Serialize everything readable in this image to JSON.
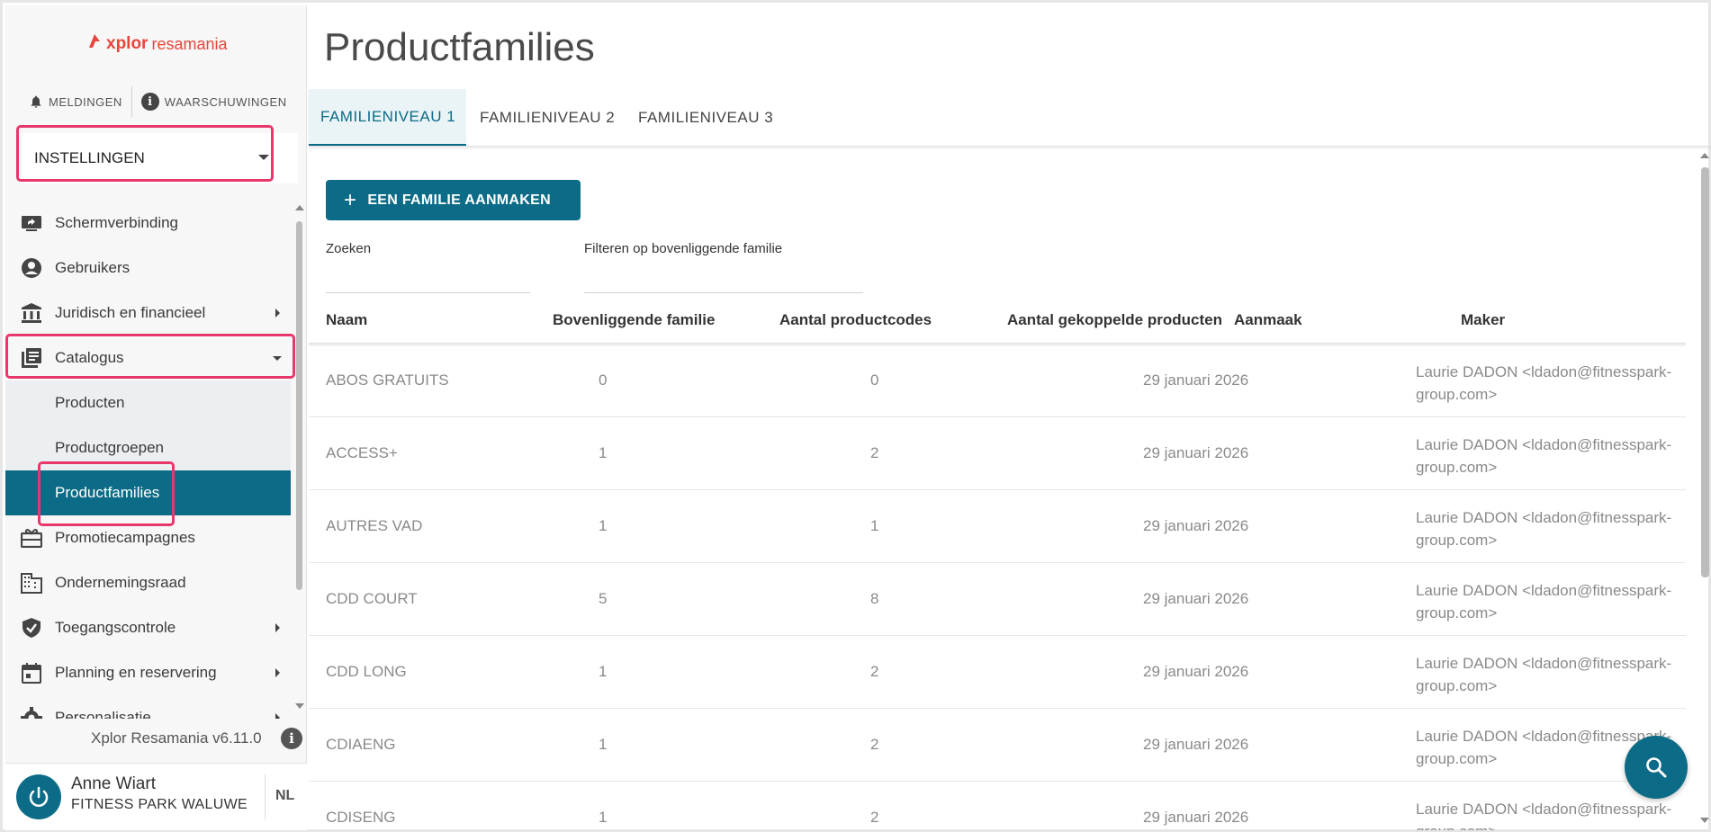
{
  "brand": {
    "logo_text_x": "xplor",
    "logo_text_r": "resamania"
  },
  "header_alerts": {
    "notifications": "MELDINGEN",
    "warnings": "WAARSCHUWINGEN"
  },
  "section_select": {
    "value": "INSTELLINGEN"
  },
  "sidebar": {
    "items": [
      {
        "label": "Schermverbinding",
        "icon": "screen-share-icon"
      },
      {
        "label": "Gebruikers",
        "icon": "account-circle-icon"
      },
      {
        "label": "Juridisch en financieel",
        "icon": "bank-icon"
      },
      {
        "label": "Catalogus",
        "icon": "library-books-icon"
      },
      {
        "label": "Producten"
      },
      {
        "label": "Productgroepen"
      },
      {
        "label": "Productfamilies"
      },
      {
        "label": "Promotiecampagnes",
        "icon": "gift-card-icon"
      },
      {
        "label": "Ondernemingsraad",
        "icon": "business-icon"
      },
      {
        "label": "Toegangscontrole",
        "icon": "shield-check-icon"
      },
      {
        "label": "Planning en reservering",
        "icon": "calendar-icon"
      },
      {
        "label": "Personalisatie",
        "icon": "gear-icon"
      }
    ]
  },
  "footer": {
    "version": "Xplor Resamania v6.11.0",
    "info_glyph": "i"
  },
  "user": {
    "name": "Anne Wiart",
    "club": "FITNESS PARK WALUWE",
    "language": "NL"
  },
  "page": {
    "title": "Productfamilies"
  },
  "tabs": [
    {
      "label": "FAMILIENIVEAU 1"
    },
    {
      "label": "FAMILIENIVEAU 2"
    },
    {
      "label": "FAMILIENIVEAU 3"
    }
  ],
  "create_button": {
    "label": "EEN FAMILIE AANMAKEN",
    "glyph": "+"
  },
  "filters": {
    "search_label": "Zoeken",
    "parent_filter_label": "Filteren op bovenliggende familie"
  },
  "table": {
    "headers": {
      "name": "Naam",
      "parent": "Bovenliggende familie",
      "product_codes": "Aantal productcodes",
      "linked_products": "Aantal gekoppelde producten",
      "created": "Aanmaak",
      "maker": "Maker"
    },
    "rows": [
      {
        "name": "ABOS GRATUITS",
        "parent": "0",
        "codes": "0",
        "created": "29 januari 2026",
        "maker_1": "Laurie DADON <ldadon@fitnesspark-",
        "maker_2": "group.com>"
      },
      {
        "name": "ACCESS+",
        "parent": "1",
        "codes": "2",
        "created": "29 januari 2026",
        "maker_1": "Laurie DADON <ldadon@fitnesspark-",
        "maker_2": "group.com>"
      },
      {
        "name": "AUTRES VAD",
        "parent": "1",
        "codes": "1",
        "created": "29 januari 2026",
        "maker_1": "Laurie DADON <ldadon@fitnesspark-",
        "maker_2": "group.com>"
      },
      {
        "name": "CDD COURT",
        "parent": "5",
        "codes": "8",
        "created": "29 januari 2026",
        "maker_1": "Laurie DADON <ldadon@fitnesspark-",
        "maker_2": "group.com>"
      },
      {
        "name": "CDD LONG",
        "parent": "1",
        "codes": "2",
        "created": "29 januari 2026",
        "maker_1": "Laurie DADON <ldadon@fitnesspark-",
        "maker_2": "group.com>"
      },
      {
        "name": "CDIAENG",
        "parent": "1",
        "codes": "2",
        "created": "29 januari 2026",
        "maker_1": "Laurie DADON <ldadon@fitnesspark-",
        "maker_2": "group.com>"
      },
      {
        "name": "CDISENG",
        "parent": "1",
        "codes": "2",
        "created": "29 januari 2026",
        "maker_1": "Laurie DADON <ldadon@fitnesspark-",
        "maker_2": "group.com>"
      }
    ]
  },
  "colors": {
    "accent": "#0c6b86",
    "highlight": "#e8376b",
    "brand": "#e8453c"
  }
}
